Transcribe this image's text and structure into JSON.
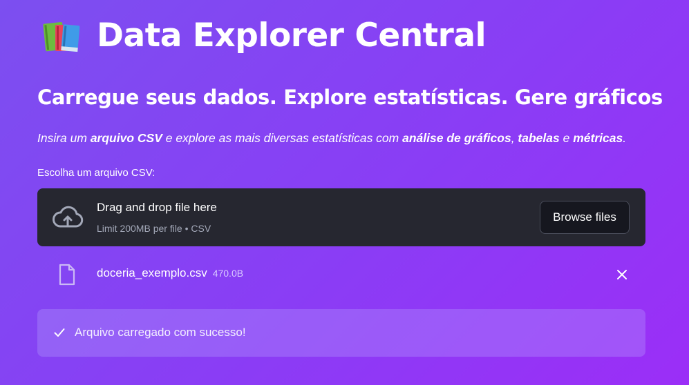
{
  "header": {
    "title": "Data Explorer Central",
    "icon": "books-icon"
  },
  "hero": {
    "subtitle": "Carregue seus dados. Explore estatísticas. Gere gráficos",
    "intro": {
      "t1": "Insira um ",
      "b1": "arquivo CSV",
      "t2": " e explore as mais diversas estatísticas com ",
      "b2": "análise de gráficos",
      "t3": ", ",
      "b3": "tabelas",
      "t4": " e ",
      "b4": "métricas",
      "t5": "."
    }
  },
  "uploader": {
    "label": "Escolha um arquivo CSV:",
    "drop_title": "Drag and drop file here",
    "limit_text": "Limit 200MB per file • CSV",
    "browse_label": "Browse files",
    "icon": "cloud-upload-icon"
  },
  "uploaded_file": {
    "name": "doceria_exemplo.csv",
    "size": "470.0B",
    "icon": "file-icon",
    "remove_icon": "close-icon"
  },
  "alert": {
    "message": "Arquivo carregado com sucesso!",
    "icon": "check-icon"
  },
  "colors": {
    "background_start": "#7c4ff0",
    "background_end": "#9b2ef7",
    "dropzone": "#262730",
    "button": "#16171f",
    "success_bg": "rgba(185,170,255,0.30)"
  }
}
